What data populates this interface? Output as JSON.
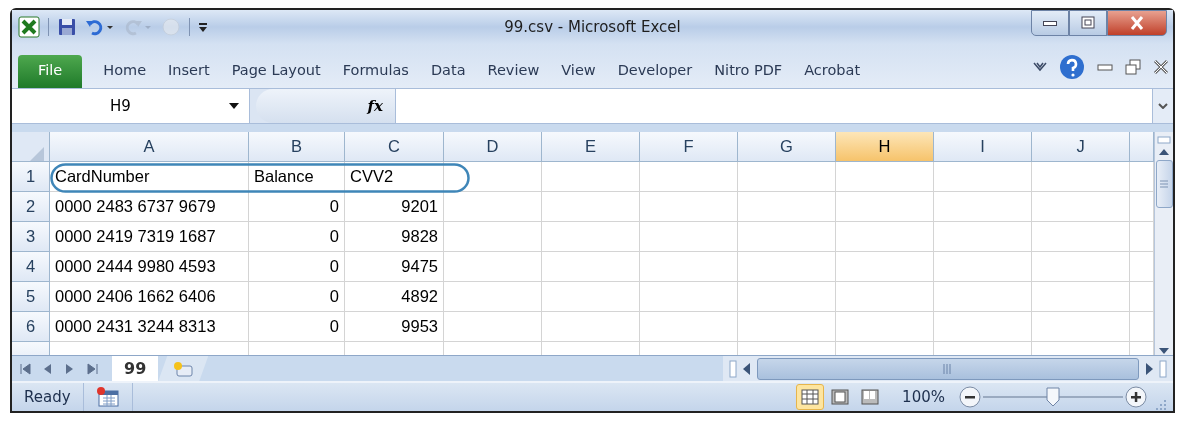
{
  "window": {
    "title": "99.csv - Microsoft Excel"
  },
  "quick_access": [
    {
      "kind": "save",
      "disabled": false
    },
    {
      "kind": "undo",
      "disabled": false
    },
    {
      "kind": "redo",
      "disabled": true
    },
    {
      "kind": "circle",
      "disabled": true
    }
  ],
  "ribbon_tabs": [
    {
      "label": "File",
      "kind": "file",
      "selected": false
    },
    {
      "label": "Home",
      "kind": "tab",
      "selected": false
    },
    {
      "label": "Insert",
      "kind": "tab",
      "selected": false
    },
    {
      "label": "Page Layout",
      "kind": "tab",
      "selected": false
    },
    {
      "label": "Formulas",
      "kind": "tab",
      "selected": false
    },
    {
      "label": "Data",
      "kind": "tab",
      "selected": false
    },
    {
      "label": "Review",
      "kind": "tab",
      "selected": false
    },
    {
      "label": "View",
      "kind": "tab",
      "selected": false
    },
    {
      "label": "Developer",
      "kind": "tab",
      "selected": false
    },
    {
      "label": "Nitro PDF",
      "kind": "tab",
      "selected": false
    },
    {
      "label": "Acrobat",
      "kind": "tab",
      "selected": false
    }
  ],
  "formula_bar": {
    "name_box": "H9",
    "function_label": "fx"
  },
  "columns": [
    {
      "label": "A",
      "selected": false
    },
    {
      "label": "B",
      "selected": false
    },
    {
      "label": "C",
      "selected": false
    },
    {
      "label": "D",
      "selected": false
    },
    {
      "label": "E",
      "selected": false
    },
    {
      "label": "F",
      "selected": false
    },
    {
      "label": "G",
      "selected": false
    },
    {
      "label": "H",
      "selected": true
    },
    {
      "label": "I",
      "selected": false
    },
    {
      "label": "J",
      "selected": false
    }
  ],
  "rows": [
    {
      "number": "1",
      "cells": [
        {
          "text": "CardNumber",
          "kind": "text"
        },
        {
          "text": "Balance",
          "kind": "text"
        },
        {
          "text": "CVV2",
          "kind": "text"
        }
      ]
    },
    {
      "number": "2",
      "cells": [
        {
          "text": "0000 2483 6737 9679",
          "kind": "text"
        },
        {
          "text": "0",
          "kind": "number"
        },
        {
          "text": "9201",
          "kind": "number"
        }
      ]
    },
    {
      "number": "3",
      "cells": [
        {
          "text": "0000 2419 7319 1687",
          "kind": "text"
        },
        {
          "text": "0",
          "kind": "number"
        },
        {
          "text": "9828",
          "kind": "number"
        }
      ]
    },
    {
      "number": "4",
      "cells": [
        {
          "text": "0000 2444 9980 4593",
          "kind": "text"
        },
        {
          "text": "0",
          "kind": "number"
        },
        {
          "text": "9475",
          "kind": "number"
        }
      ]
    },
    {
      "number": "5",
      "cells": [
        {
          "text": "0000 2406 1662 6406",
          "kind": "text"
        },
        {
          "text": "0",
          "kind": "number"
        },
        {
          "text": "4892",
          "kind": "number"
        }
      ]
    },
    {
      "number": "6",
      "cells": [
        {
          "text": "0000 2431 3244 8313",
          "kind": "text"
        },
        {
          "text": "0",
          "kind": "number"
        },
        {
          "text": "9953",
          "kind": "number"
        }
      ]
    }
  ],
  "sheet_tabs": [
    {
      "label": "99",
      "selected": true
    }
  ],
  "status_bar": {
    "status": "Ready",
    "zoom": "100%",
    "zoom_level": {
      "level": 0.5
    },
    "views": [
      {
        "kind": "normal",
        "selected": true
      },
      {
        "kind": "layout",
        "selected": false
      },
      {
        "kind": "break",
        "selected": false
      }
    ]
  }
}
